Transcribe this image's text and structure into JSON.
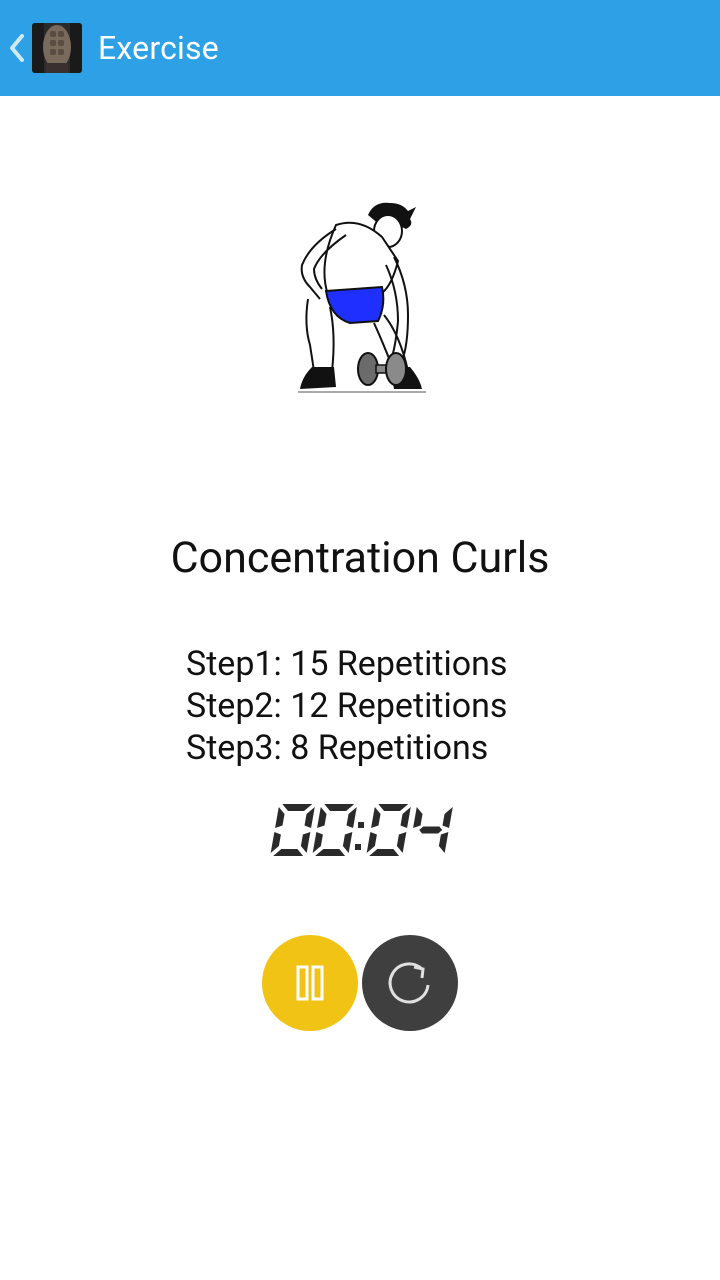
{
  "actionbar": {
    "title": "Exercise",
    "background": "#2ea1e6",
    "up_icon": "chevron-left-icon",
    "app_icon": "app-logo"
  },
  "exercise": {
    "name": "Concentration Curls",
    "steps": [
      "Step1: 15 Repetitions",
      "Step2: 12 Repetitions",
      "Step3: 8 Repetitions"
    ],
    "illustration": "concentration-curl-figure"
  },
  "timer": {
    "display": "00:04",
    "digits": [
      "0",
      "0",
      "0",
      "4"
    ]
  },
  "controls": {
    "pause_icon": "pause-icon",
    "pause_color": "#f0c315",
    "reset_icon": "refresh-icon",
    "reset_color": "#3f3f3f"
  }
}
